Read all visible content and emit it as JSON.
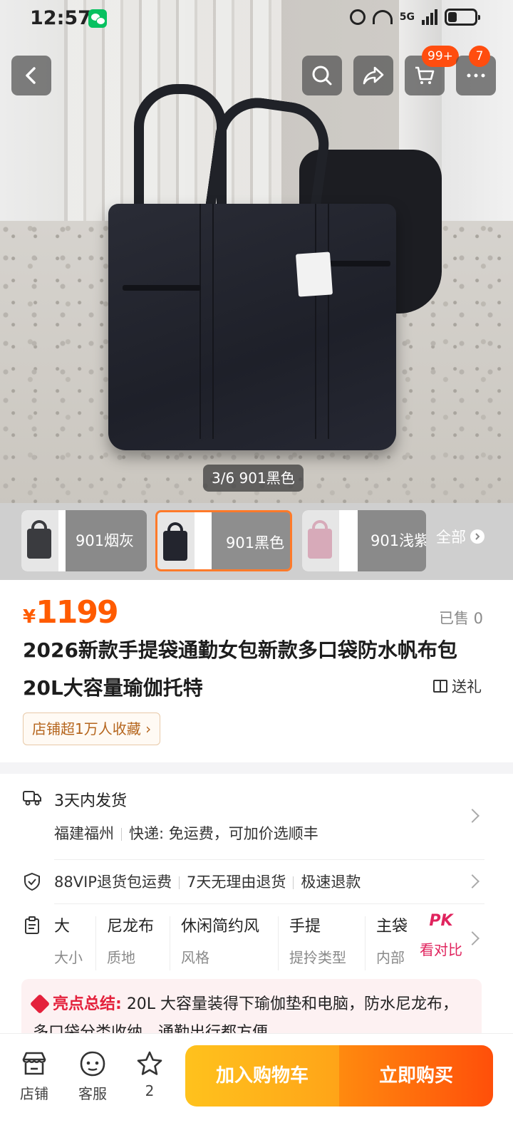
{
  "status_bar": {
    "time": "12:57",
    "network": "5G"
  },
  "header": {
    "cart_badge": "99+",
    "more_badge": "7"
  },
  "gallery": {
    "counter": "3/6 901黑色"
  },
  "sku": {
    "options": [
      {
        "label": "901烟灰",
        "swatch": "#3a3b3f"
      },
      {
        "label": "901黑色",
        "swatch": "#23252e"
      },
      {
        "label": "901浅紫",
        "swatch": "#d7aab9"
      }
    ],
    "all_label": "全部"
  },
  "product": {
    "currency": "¥",
    "price": "1199",
    "sold": "已售 0",
    "title": "2026新款手提袋通勤女包新款多口袋防水帆布包20L大容量瑜伽托特",
    "gift": "送礼",
    "shop_fav": "店铺超1万人收藏 ›"
  },
  "shipping": {
    "title": "3天内发货",
    "origin": "福建福州",
    "express": "快递: 免运费，可加价选顺丰"
  },
  "guarantees": [
    "88VIP退货包运费",
    "7天无理由退货",
    "极速退款"
  ],
  "attributes": [
    {
      "value": "大",
      "key": "大小"
    },
    {
      "value": "尼龙布",
      "key": "质地"
    },
    {
      "value": "休闲简约风",
      "key": "风格"
    },
    {
      "value": "手提",
      "key": "提拎类型"
    },
    {
      "value": "主袋",
      "key": "内部"
    }
  ],
  "pk": {
    "icon": "PK",
    "label": "看对比"
  },
  "highlight": {
    "head": "亮点总结:",
    "text": "20L 大容量装得下瑜伽垫和电脑，防水尼龙布，多口袋分类收纳，通勤出行都方便"
  },
  "bottom_bar": {
    "shop": "店铺",
    "service": "客服",
    "fav_count": "2",
    "add_cart": "加入购物车",
    "buy_now": "立即购买"
  },
  "colors": {
    "accent": "#ff5b00",
    "cart_btn": "#ffb01b",
    "buy_btn": "#ff5a0b",
    "badge": "#ff4d0f"
  }
}
